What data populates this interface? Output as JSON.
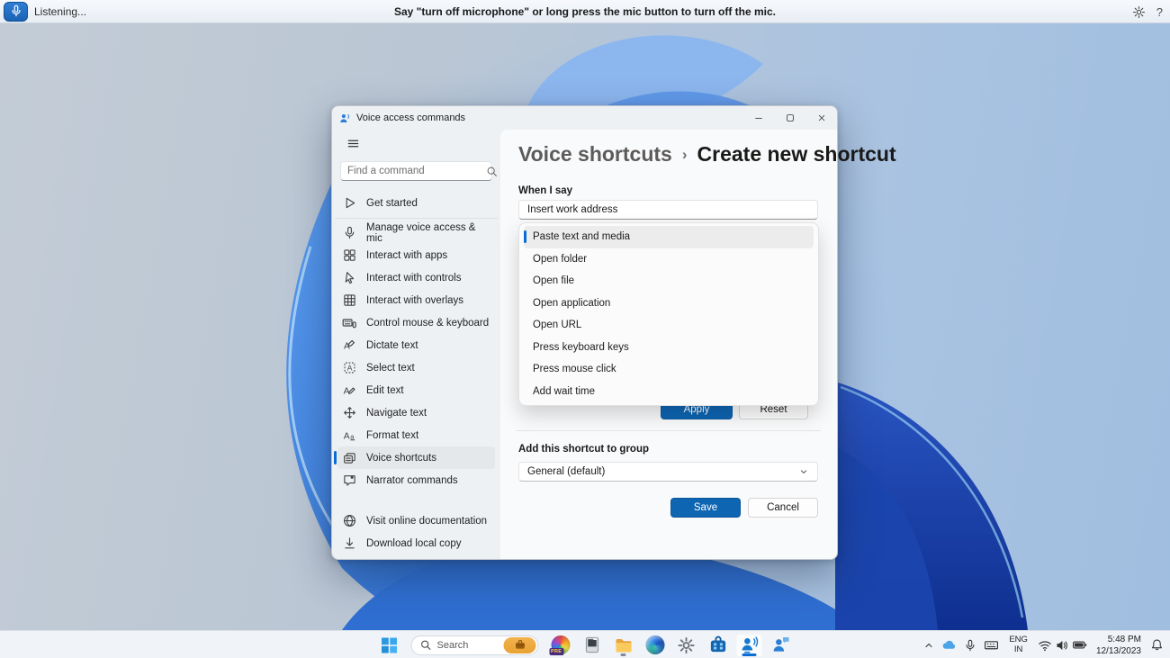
{
  "colors": {
    "accent": "#0e65b2",
    "selection_bar": "#0a6cd6"
  },
  "voice_bar": {
    "status": "Listening...",
    "message": "Say \"turn off microphone\" or long press the mic button to turn off the mic."
  },
  "window": {
    "title": "Voice access commands",
    "sidebar": {
      "search_placeholder": "Find a command",
      "items": [
        {
          "icon": "play-icon",
          "label": "Get started",
          "divider_after": true
        },
        {
          "icon": "microphone-icon",
          "label": "Manage voice access & mic"
        },
        {
          "icon": "apps-grid-icon",
          "label": "Interact with apps"
        },
        {
          "icon": "cursor-icon",
          "label": "Interact with controls"
        },
        {
          "icon": "overlay-grid-icon",
          "label": "Interact with overlays"
        },
        {
          "icon": "keyboard-mouse-icon",
          "label": "Control mouse & keyboard"
        },
        {
          "icon": "dictate-text-icon",
          "label": "Dictate text"
        },
        {
          "icon": "select-text-icon",
          "label": "Select text"
        },
        {
          "icon": "edit-text-icon",
          "label": "Edit text"
        },
        {
          "icon": "navigate-text-icon",
          "label": "Navigate text"
        },
        {
          "icon": "format-text-icon",
          "label": "Format text"
        },
        {
          "icon": "voice-shortcuts-icon",
          "label": "Voice shortcuts",
          "selected": true
        },
        {
          "icon": "narrator-icon",
          "label": "Narrator commands"
        }
      ],
      "footer_items": [
        {
          "icon": "globe-icon",
          "label": "Visit online documentation"
        },
        {
          "icon": "download-icon",
          "label": "Download local copy"
        }
      ]
    },
    "content": {
      "breadcrumb_parent": "Voice shortcuts",
      "breadcrumb_separator": "›",
      "breadcrumb_current": "Create new shortcut",
      "when_i_say_label": "When I say",
      "when_i_say_value": "Insert work address",
      "menu_items": [
        {
          "label": "Paste text and media",
          "selected": true
        },
        {
          "label": "Open folder"
        },
        {
          "label": "Open file"
        },
        {
          "label": "Open application"
        },
        {
          "label": "Open URL"
        },
        {
          "label": "Press keyboard keys"
        },
        {
          "label": "Press mouse click"
        },
        {
          "label": "Add wait time"
        }
      ],
      "apply_label": "Apply",
      "reset_label": "Reset",
      "group_label": "Add this shortcut to group",
      "group_value": "General (default)",
      "save_label": "Save",
      "cancel_label": "Cancel"
    }
  },
  "taskbar": {
    "search_placeholder": "Search",
    "tray": {
      "language_top": "ENG",
      "language_bottom": "IN",
      "time": "5:48 PM",
      "date": "12/13/2023"
    }
  }
}
